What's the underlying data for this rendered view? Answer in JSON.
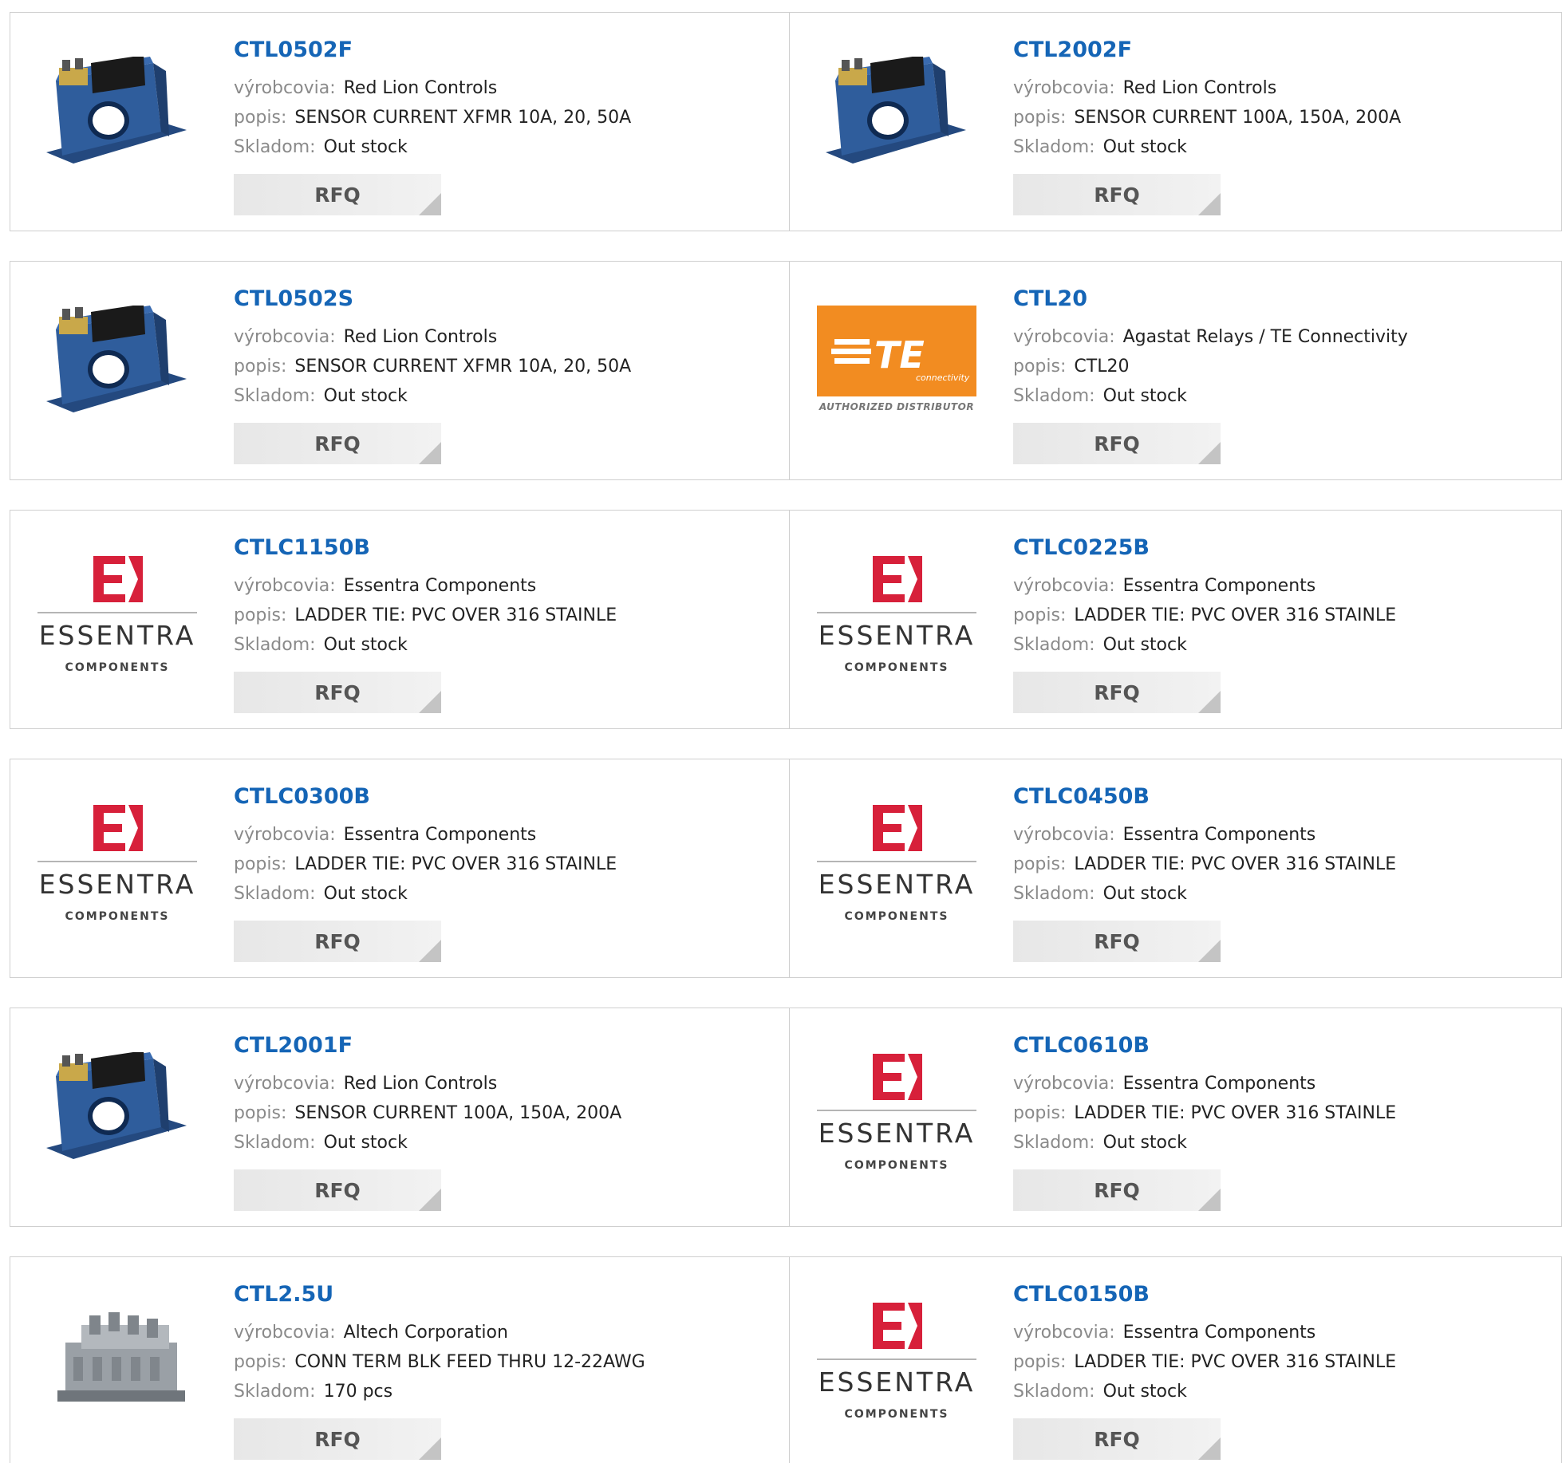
{
  "labels": {
    "manufacturer": "výrobcovia:",
    "description": "popis:",
    "stock": "Skladom:",
    "rfq": "RFQ"
  },
  "logos": {
    "te_text": "TE",
    "te_sub": "connectivity",
    "te_caption": "AUTHORIZED DISTRIBUTOR",
    "essentra_word": "ESSENTRA",
    "essentra_sub": "COMPONENTS"
  },
  "colors": {
    "link": "#1565b6",
    "essentra_red": "#d7203a",
    "te_orange": "#f28c21",
    "redlion_blue": "#2f5d9c"
  },
  "products": [
    {
      "part": "CTL0502F",
      "manufacturer": "Red Lion Controls",
      "description": "SENSOR CURRENT XFMR 10A, 20, 50A",
      "stock": "Out stock",
      "image": "redlion"
    },
    {
      "part": "CTL2002F",
      "manufacturer": "Red Lion Controls",
      "description": "SENSOR CURRENT 100A, 150A, 200A",
      "stock": "Out stock",
      "image": "redlion"
    },
    {
      "part": "CTL0502S",
      "manufacturer": "Red Lion Controls",
      "description": "SENSOR CURRENT XFMR 10A, 20, 50A",
      "stock": "Out stock",
      "image": "redlion"
    },
    {
      "part": "CTL20",
      "manufacturer": "Agastat Relays / TE Connectivity",
      "description": "CTL20",
      "stock": "Out stock",
      "image": "te"
    },
    {
      "part": "CTLC1150B",
      "manufacturer": "Essentra Components",
      "description": "LADDER TIE: PVC OVER 316 STAINLE",
      "stock": "Out stock",
      "image": "essentra"
    },
    {
      "part": "CTLC0225B",
      "manufacturer": "Essentra Components",
      "description": "LADDER TIE: PVC OVER 316 STAINLE",
      "stock": "Out stock",
      "image": "essentra"
    },
    {
      "part": "CTLC0300B",
      "manufacturer": "Essentra Components",
      "description": "LADDER TIE: PVC OVER 316 STAINLE",
      "stock": "Out stock",
      "image": "essentra"
    },
    {
      "part": "CTLC0450B",
      "manufacturer": "Essentra Components",
      "description": "LADDER TIE: PVC OVER 316 STAINLE",
      "stock": "Out stock",
      "image": "essentra"
    },
    {
      "part": "CTL2001F",
      "manufacturer": "Red Lion Controls",
      "description": "SENSOR CURRENT 100A, 150A, 200A",
      "stock": "Out stock",
      "image": "redlion"
    },
    {
      "part": "CTLC0610B",
      "manufacturer": "Essentra Components",
      "description": "LADDER TIE: PVC OVER 316 STAINLE",
      "stock": "Out stock",
      "image": "essentra"
    },
    {
      "part": "CTL2.5U",
      "manufacturer": "Altech Corporation",
      "description": "CONN TERM BLK FEED THRU 12-22AWG",
      "stock": "170 pcs",
      "image": "terminal"
    },
    {
      "part": "CTLC0150B",
      "manufacturer": "Essentra Components",
      "description": "LADDER TIE: PVC OVER 316 STAINLE",
      "stock": "Out stock",
      "image": "essentra"
    }
  ]
}
